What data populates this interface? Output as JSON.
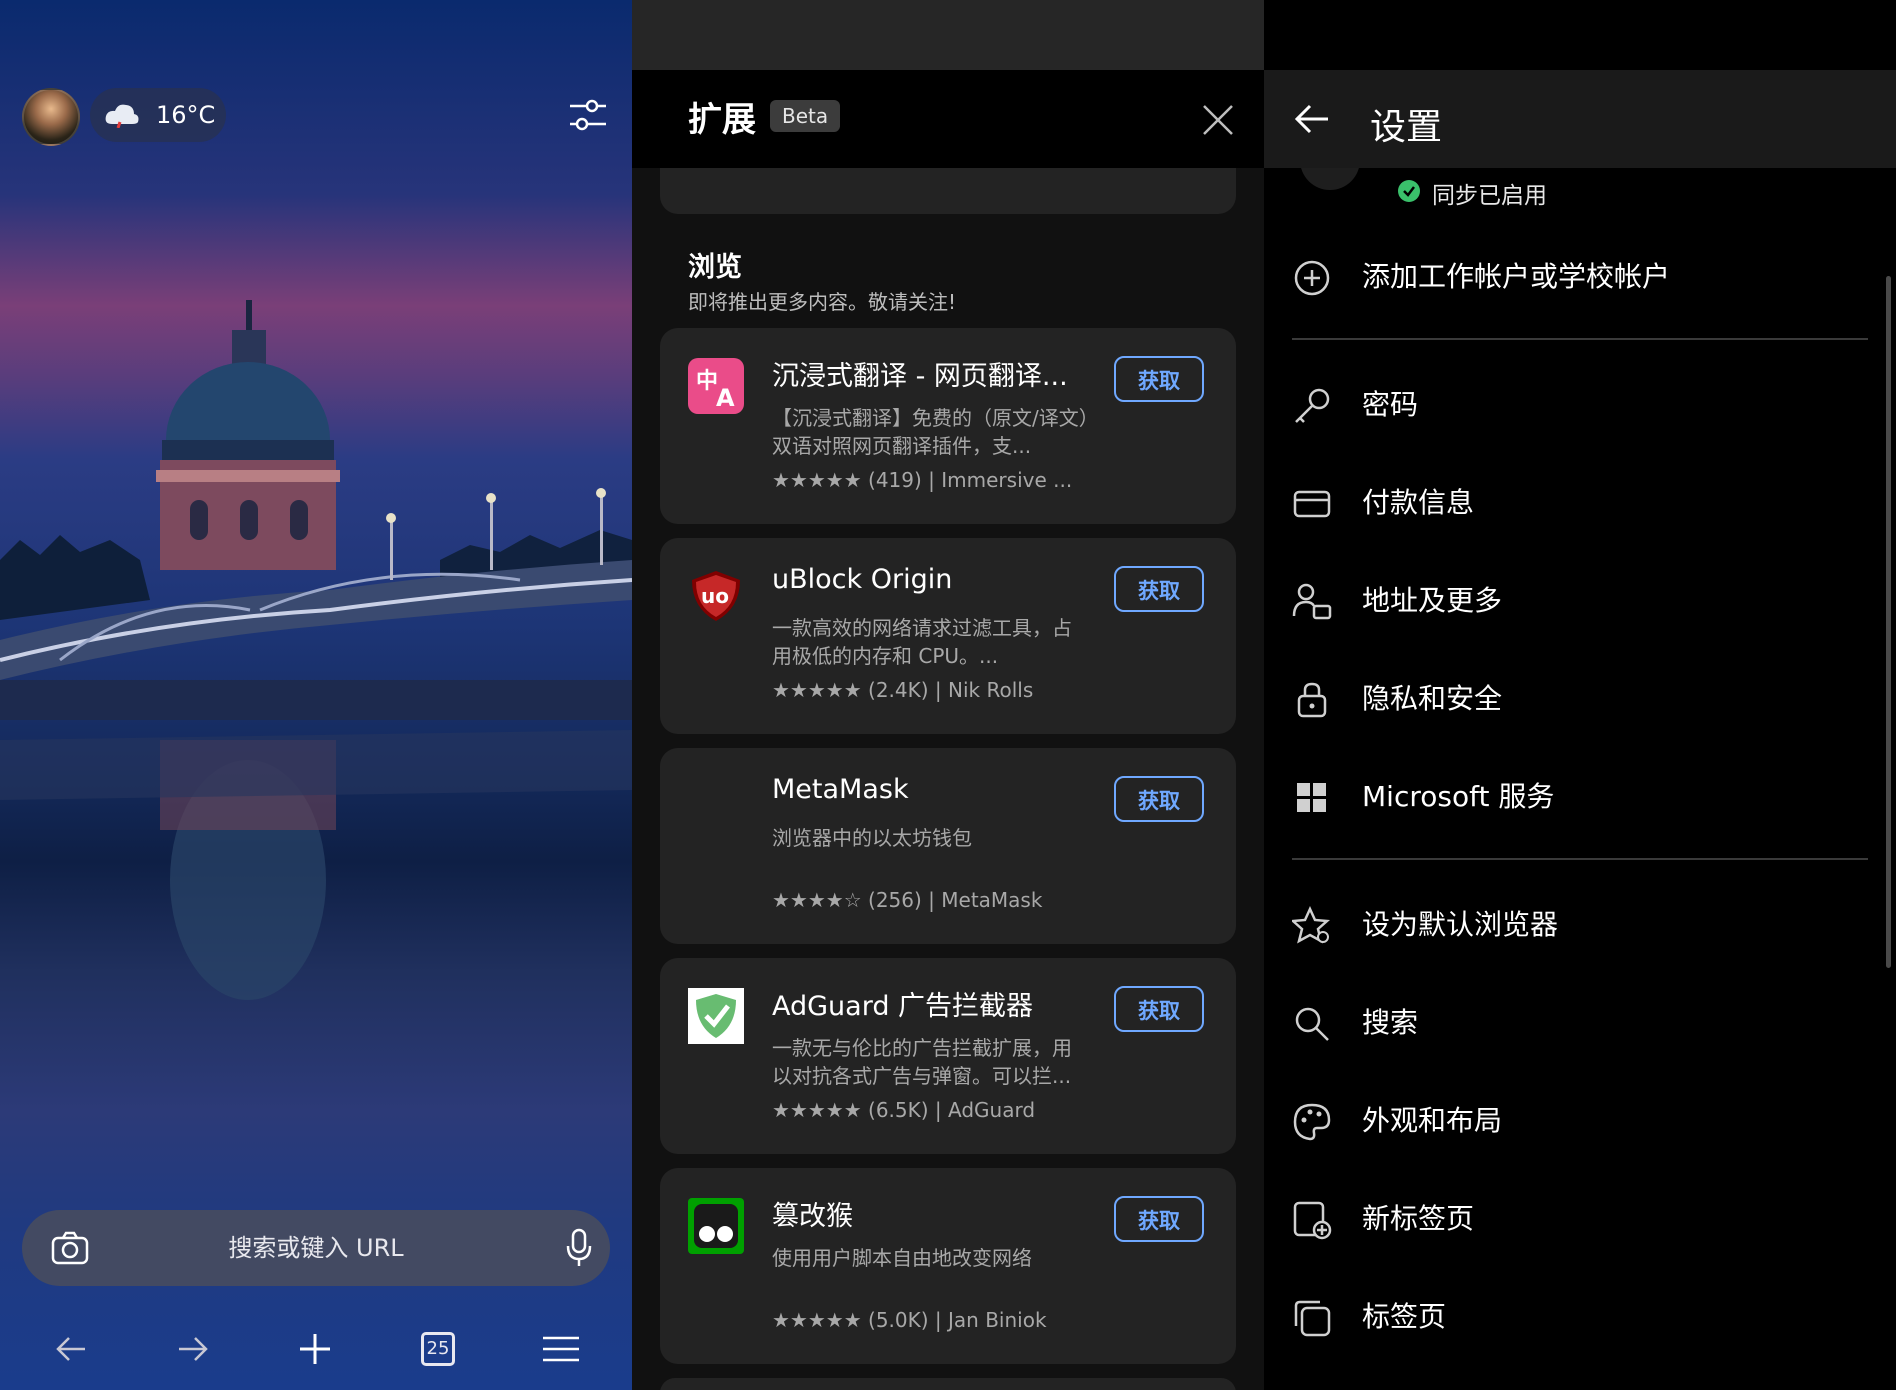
{
  "new_tab": {
    "weather_temp": "16°C",
    "search_placeholder": "搜索或键入 URL",
    "tab_count": "25",
    "icons": [
      "avatar",
      "cloud-rain-icon",
      "filter-icon",
      "camera-icon",
      "mic-icon",
      "back-icon",
      "forward-icon",
      "new-tab-icon",
      "tab-count-icon",
      "menu-icon"
    ]
  },
  "extensions": {
    "title": "扩展",
    "beta_badge": "Beta",
    "section_title": "浏览",
    "section_subtitle": "即将推出更多内容。敬请关注!",
    "items": [
      {
        "name": "沉浸式翻译 - 网页翻译...",
        "desc": "【沉浸式翻译】免费的（原文/译文）双语对照网页翻译插件，支...",
        "stars": "★★★★★",
        "rating_count": "(419)",
        "author": "Immersive ...",
        "button": "获取"
      },
      {
        "name": "uBlock Origin",
        "desc": "一款高效的网络请求过滤工具，占用极低的内存和 CPU。...",
        "stars": "★★★★★",
        "rating_count": "(2.4K)",
        "author": "Nik Rolls",
        "button": "获取"
      },
      {
        "name": "MetaMask",
        "desc": "浏览器中的以太坊钱包",
        "stars": "★★★★☆",
        "rating_count": "(256)",
        "author": "MetaMask",
        "button": "获取"
      },
      {
        "name": "AdGuard 广告拦截器",
        "desc": "一款无与伦比的广告拦截扩展，用以对抗各式广告与弹窗。可以拦...",
        "stars": "★★★★★",
        "rating_count": "(6.5K)",
        "author": "AdGuard",
        "button": "获取"
      },
      {
        "name": "篡改猴",
        "desc": "使用用户脚本自由地改变网络",
        "stars": "★★★★★",
        "rating_count": "(5.0K)",
        "author": "Jan Biniok",
        "button": "获取"
      }
    ],
    "separator": "|",
    "accent_color": "#6fa8ff"
  },
  "settings": {
    "title": "设置",
    "sync_status": "同步已启用",
    "add_account": "添加工作帐户或学校帐户",
    "items": [
      {
        "label": "密码",
        "icon": "key-icon"
      },
      {
        "label": "付款信息",
        "icon": "card-icon"
      },
      {
        "label": "地址及更多",
        "icon": "address-icon"
      },
      {
        "label": "隐私和安全",
        "icon": "lock-icon"
      },
      {
        "label": "Microsoft 服务",
        "icon": "microsoft-icon"
      }
    ],
    "items2": [
      {
        "label": "设为默认浏览器",
        "icon": "star-icon"
      },
      {
        "label": "搜索",
        "icon": "search-icon"
      },
      {
        "label": "外观和布局",
        "icon": "palette-icon"
      },
      {
        "label": "新标签页",
        "icon": "new-tab-page-icon"
      },
      {
        "label": "标签页",
        "icon": "tabs-icon"
      }
    ],
    "status_color": "#3ac06b"
  }
}
